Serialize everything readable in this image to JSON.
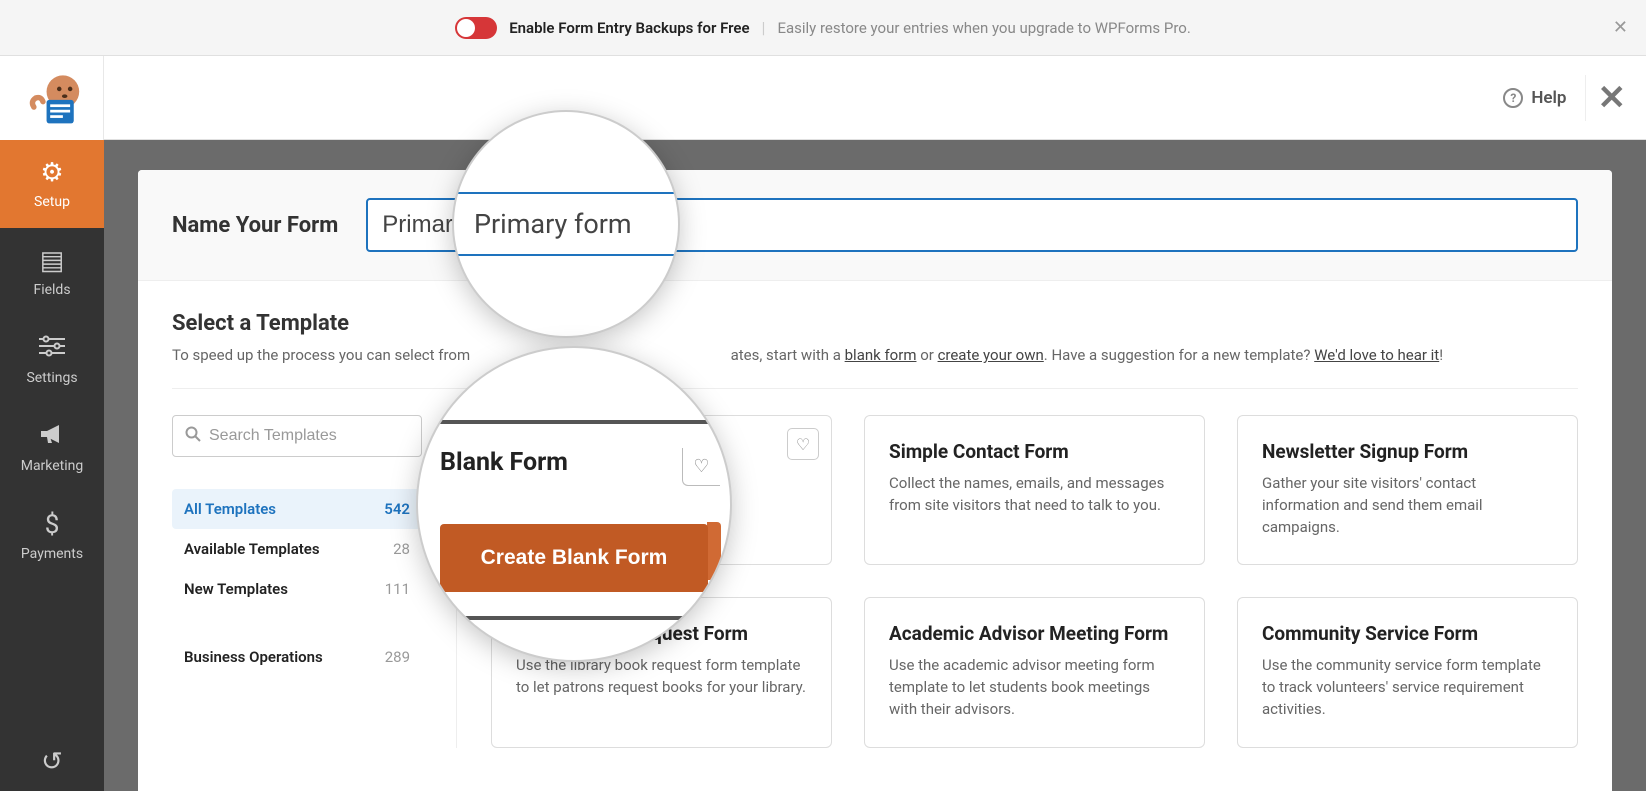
{
  "banner": {
    "bold": "Enable Form Entry Backups for Free",
    "light": "Easily restore your entries when you upgrade to WPForms Pro."
  },
  "header": {
    "help": "Help"
  },
  "sidebar": {
    "items": [
      {
        "label": "Setup",
        "active": true
      },
      {
        "label": "Fields",
        "active": false
      },
      {
        "label": "Settings",
        "active": false
      },
      {
        "label": "Marketing",
        "active": false
      },
      {
        "label": "Payments",
        "active": false
      }
    ]
  },
  "nameSection": {
    "label": "Name Your Form",
    "value": "Primary form"
  },
  "templateSection": {
    "title": "Select a Template",
    "descPrefix": "To speed up the process you can select from",
    "descMid": "ates, start with a ",
    "link1": "blank form",
    "descOr": " or ",
    "link2": "create your own",
    "descSuggest": ". Have a suggestion for a new template? ",
    "link3": "We'd love to hear it",
    "descEnd": "!"
  },
  "search": {
    "placeholder": "Search Templates"
  },
  "categories": [
    {
      "name": "All Templates",
      "count": "542",
      "active": true
    },
    {
      "name": "Available Templates",
      "count": "28",
      "active": false
    },
    {
      "name": "New Templates",
      "count": "111",
      "active": false
    },
    {
      "name": "Business Operations",
      "count": "289",
      "active": false
    }
  ],
  "templates": [
    {
      "title": "Blank Form",
      "desc": "",
      "fav": true
    },
    {
      "title": "Simple Contact Form",
      "desc": "Collect the names, emails, and messages from site visitors that need to talk to you."
    },
    {
      "title": "Newsletter Signup Form",
      "desc": "Gather your site visitors' contact information and send them email campaigns."
    },
    {
      "title": "Library Book Request Form",
      "desc": "Use the library book request form template to let patrons request books for your library."
    },
    {
      "title": "Academic Advisor Meeting Form",
      "desc": "Use the academic advisor meeting form template to let students book meetings with their advisors."
    },
    {
      "title": "Community Service Form",
      "desc": "Use the community service form template to track volunteers' service requirement activities."
    }
  ],
  "magnify": {
    "primaryText": "Primary form",
    "blankTitle": "Blank Form",
    "blankButton": "Create Blank Form"
  }
}
